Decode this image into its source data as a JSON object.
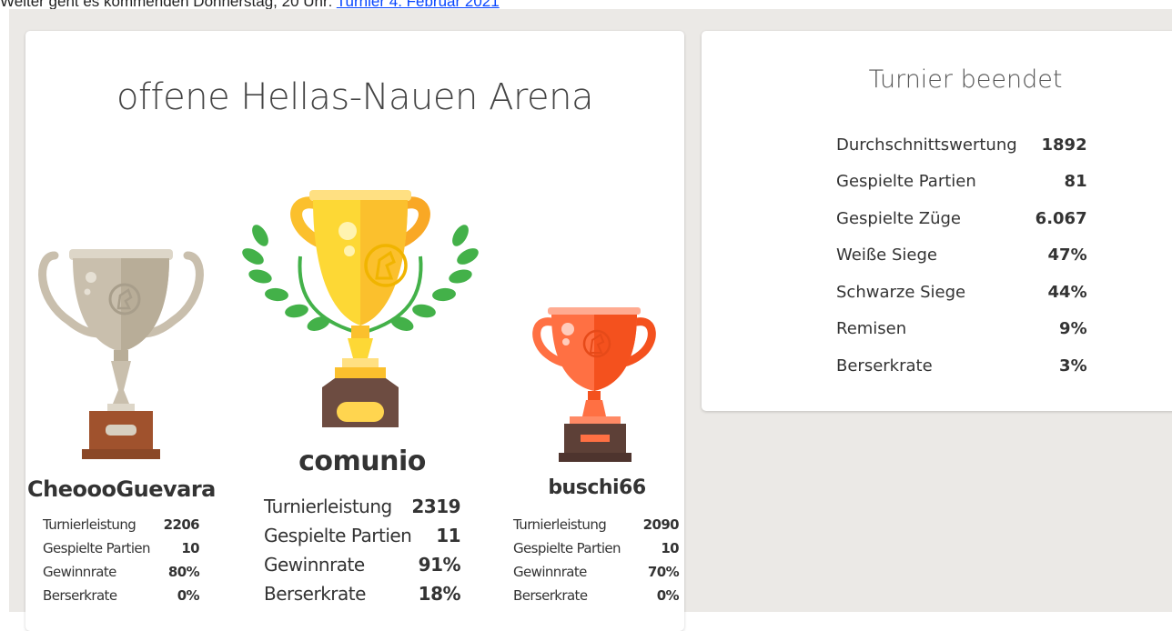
{
  "announcement": {
    "text": "Weiter geht es kommenden Donnerstag, 20 Uhr: ",
    "link_label": "Turnier 4. Februar 2021"
  },
  "podium": {
    "title": "offene Hellas-Nauen Arena",
    "first": {
      "name": "comunio",
      "stats": [
        {
          "label": "Turnierleistung",
          "value": "2319"
        },
        {
          "label": "Gespielte Partien",
          "value": "11"
        },
        {
          "label": "Gewinnrate",
          "value": "91%"
        },
        {
          "label": "Berserkrate",
          "value": "18%"
        }
      ]
    },
    "second": {
      "name": "CheoooGuevara",
      "stats": [
        {
          "label": "Turnierleistung",
          "value": "2206"
        },
        {
          "label": "Gespielte Partien",
          "value": "10"
        },
        {
          "label": "Gewinnrate",
          "value": "80%"
        },
        {
          "label": "Berserkrate",
          "value": "0%"
        }
      ]
    },
    "third": {
      "name": "buschi66",
      "stats": [
        {
          "label": "Turnierleistung",
          "value": "2090"
        },
        {
          "label": "Gespielte Partien",
          "value": "10"
        },
        {
          "label": "Gewinnrate",
          "value": "70%"
        },
        {
          "label": "Berserkrate",
          "value": "0%"
        }
      ]
    }
  },
  "tournament_stats": {
    "title": "Turnier beendet",
    "rows": [
      {
        "label": "Durchschnittswertung",
        "value": "1892"
      },
      {
        "label": "Gespielte Partien",
        "value": "81"
      },
      {
        "label": "Gespielte Züge",
        "value": "6.067"
      },
      {
        "label": "Weiße Siege",
        "value": "47%"
      },
      {
        "label": "Schwarze Siege",
        "value": "44%"
      },
      {
        "label": "Remisen",
        "value": "9%"
      },
      {
        "label": "Berserkrate",
        "value": "3%"
      }
    ]
  },
  "colors": {
    "gold": "#fbc02d",
    "silver": "#c9bfad",
    "bronze": "#ff7043",
    "laurel": "#43b149",
    "link": "#0645ff",
    "page_bg": "#ebe9e6"
  }
}
